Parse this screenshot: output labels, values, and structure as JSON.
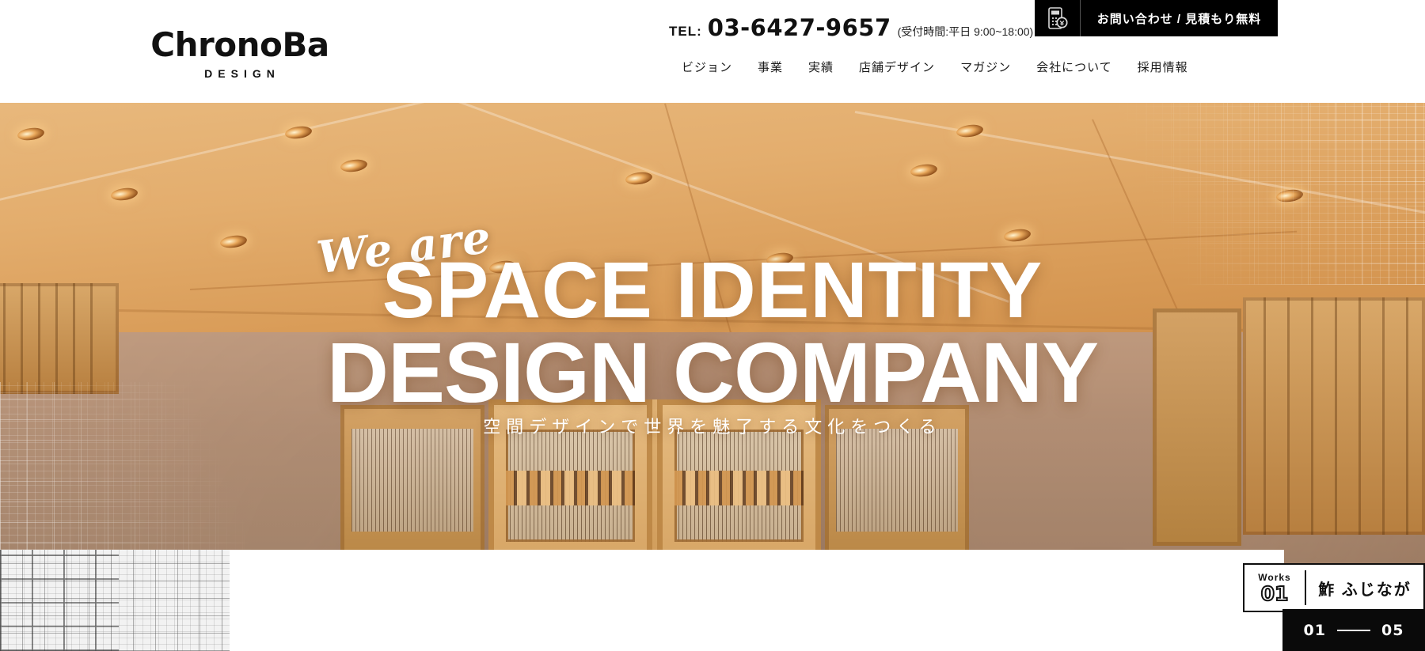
{
  "header": {
    "logo": {
      "word": "ChronoBa",
      "sub": "DESIGN",
      "icon": "chronoba-logo"
    },
    "tel": {
      "label": "TEL:",
      "number": "03-6427-9657",
      "hours": "(受付時間:平日 9:00~18:00)"
    },
    "contact_button": {
      "label": "お問い合わせ / 見積もり無料",
      "icon": "calculator-estimate-icon",
      "bg": "#000000",
      "text_color": "#ffffff"
    },
    "nav": [
      {
        "label": "ビジョン",
        "name": "vision"
      },
      {
        "label": "事業",
        "name": "business"
      },
      {
        "label": "実績",
        "name": "works"
      },
      {
        "label": "店舗デザイン",
        "name": "shop-design"
      },
      {
        "label": "マガジン",
        "name": "magazine"
      },
      {
        "label": "会社について",
        "name": "about"
      },
      {
        "label": "採用情報",
        "name": "recruit"
      }
    ]
  },
  "hero": {
    "script_line": "We are",
    "headline_line1": "SPACE IDENTITY",
    "headline_line2": "DESIGN COMPANY",
    "tagline": "空間デザインで世界を魅了する文化をつくる",
    "image_alt": "木製天井と格子戸の和風店舗インテリア",
    "overlay": "blueprint-drawing"
  },
  "works_badge": {
    "kicker": "Works",
    "number": "01",
    "title": "鮓 ふじなが"
  },
  "slider": {
    "current": "01",
    "total": "05",
    "separator": "—"
  },
  "colors": {
    "accent_black": "#000000",
    "page_bg": "#ffffff",
    "hero_warm": "#d99c58",
    "chair_yellow": "#e8c23c"
  }
}
